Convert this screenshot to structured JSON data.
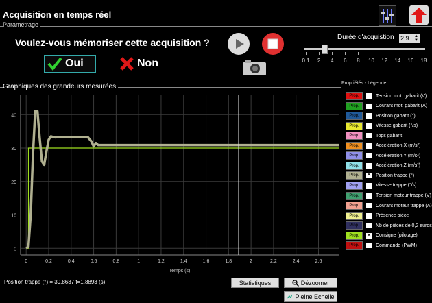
{
  "window": {
    "title": "Acquisition en temps réel"
  },
  "parametrage": {
    "label": "Paramétrage"
  },
  "save_prompt": {
    "question": "Voulez-vous mémoriser cette acquisition ?",
    "yes_label": "Oui",
    "no_label": "Non"
  },
  "duration": {
    "label": "Durée d'acquistion",
    "value": "2.9",
    "slider_value": 2.9,
    "slider_min": 0.1,
    "slider_max": 18,
    "ticks": [
      "0.1",
      "2",
      "4",
      "6",
      "8",
      "10",
      "12",
      "14",
      "16",
      "18"
    ]
  },
  "graph": {
    "title": "Graphiques des grandeurs mesurées"
  },
  "legend": {
    "title": "Propriétés - Légende",
    "prop_label": "Prop.",
    "items": [
      {
        "color": "#e01010",
        "checked": false,
        "label": "Tension mot. gabarit (V)"
      },
      {
        "color": "#20a020",
        "checked": false,
        "label": "Courant mot. gabarit (A)"
      },
      {
        "color": "#205a9a",
        "checked": false,
        "label": "Position gabarit (°)"
      },
      {
        "color": "#e8e830",
        "checked": false,
        "label": "Vitesse gabarit (°/s)"
      },
      {
        "color": "#f090c0",
        "checked": false,
        "label": "Tops gabarit"
      },
      {
        "color": "#f09020",
        "checked": false,
        "label": "Accélération X (m/s²)"
      },
      {
        "color": "#9090e8",
        "checked": false,
        "label": "Accélération Y (m/s²)"
      },
      {
        "color": "#90e0e8",
        "checked": false,
        "label": "Accélération Z (m/s²)"
      },
      {
        "color": "#b0b090",
        "checked": true,
        "label": "Position trappe (°)"
      },
      {
        "color": "#a0a0f0",
        "checked": false,
        "label": "Vitesse trappe (°/s)"
      },
      {
        "color": "#40a070",
        "checked": false,
        "label": "Tension moteur trappe (V)"
      },
      {
        "color": "#f0a090",
        "checked": false,
        "label": "Courant moteur trappe (A)"
      },
      {
        "color": "#f0f090",
        "checked": false,
        "label": "Présence pièce"
      },
      {
        "color": "#303060",
        "checked": false,
        "label": "Nb de pièces de 0,2 euros"
      },
      {
        "color": "#a0e020",
        "checked": true,
        "label": "Consigne (pilotage)"
      },
      {
        "color": "#c01010",
        "checked": false,
        "label": "Commande (PWM)"
      }
    ]
  },
  "chart_data": {
    "type": "line",
    "xlabel": "Temps (s)",
    "ylabel": "",
    "xlim": [
      -0.05,
      2.78
    ],
    "ylim": [
      -2,
      46
    ],
    "xticks": [
      0,
      0.2,
      0.4,
      0.6,
      0.8,
      1,
      1.2,
      1.4,
      1.6,
      1.8,
      2,
      2.2,
      2.4,
      2.6
    ],
    "yticks": [
      0,
      10,
      20,
      30,
      40
    ],
    "cursor_x": 1.8893,
    "grid": true,
    "series": [
      {
        "color": "#a0e020",
        "x": [
          0,
          0.02,
          0.02,
          2.78
        ],
        "y": [
          0,
          0,
          30,
          30
        ]
      },
      {
        "color": "#b0b090",
        "x": [
          0,
          0.02,
          0.04,
          0.06,
          0.08,
          0.1,
          0.12,
          0.14,
          0.16,
          0.18,
          0.2,
          0.22,
          0.24,
          0.26,
          0.3,
          0.4,
          0.5,
          0.55,
          0.58,
          0.6,
          0.62,
          0.64,
          0.7,
          1.0,
          1.5,
          2.0,
          2.5,
          2.78
        ],
        "y": [
          0,
          0.5,
          10,
          28,
          41,
          41,
          33,
          26,
          25,
          29,
          32.5,
          33.5,
          33.3,
          33.2,
          33.3,
          33.3,
          33.3,
          33.2,
          32,
          30.5,
          31.5,
          30.9,
          30.9,
          30.9,
          30.9,
          30.9,
          30.9,
          30.9
        ]
      }
    ]
  },
  "status": {
    "text": "Position trappe (°) = 30.8637  t=1.8893 (s),"
  },
  "buttons": {
    "stats": "Statistiques",
    "dezoom": "Dézoomer",
    "pleine": "Pleine Echelle"
  }
}
